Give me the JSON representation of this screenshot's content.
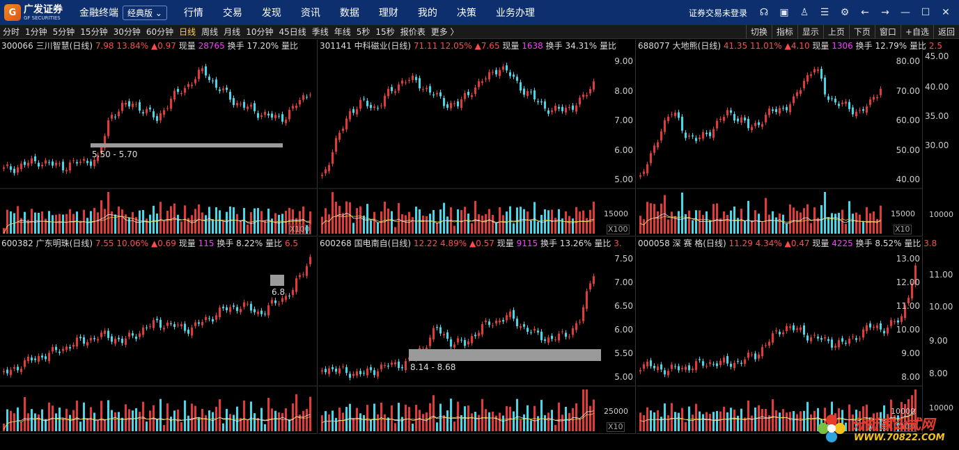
{
  "titlebar": {
    "logo_cn": "广发证券",
    "logo_en": "GF SECURITIES",
    "app_name": "金融终端",
    "edition": "经典版",
    "menu": [
      "行情",
      "交易",
      "发现",
      "资讯",
      "数据",
      "理财",
      "我的",
      "决策",
      "业务办理"
    ],
    "login_status": "证券交易未登录",
    "icons": [
      "headset-icon",
      "grid-icon",
      "shirt-icon",
      "doc-icon",
      "gear-icon",
      "back-arrow-icon",
      "forward-arrow-icon",
      "minimize-icon",
      "maximize-icon",
      "close-icon"
    ]
  },
  "period_bar": {
    "items": [
      "分时",
      "1分钟",
      "5分钟",
      "15分钟",
      "30分钟",
      "60分钟",
      "日线",
      "周线",
      "月线",
      "10分钟",
      "45日线",
      "季线",
      "年线",
      "5秒",
      "15秒",
      "报价表",
      "更多 〉"
    ],
    "active": "日线",
    "tools": [
      "切换",
      "指标",
      "显示",
      "上页",
      "下页",
      "窗口",
      "+自选",
      "返回"
    ]
  },
  "panels": [
    {
      "code": "300066",
      "name": "三川智慧(日线)",
      "price": "7.98",
      "pct": "13.84%",
      "chg": "▲0.97",
      "vol_label": "现量",
      "vol": "28765",
      "turn": "换手 17.20%",
      "ratio": "量比",
      "yticks": [],
      "vticks": [
        "X100"
      ],
      "band_label": "5.50 - 5.70"
    },
    {
      "code": "301141",
      "name": "中科磁业(日线)",
      "price": "71.11",
      "pct": "12.05%",
      "chg": "▲7.65",
      "vol_label": "现量",
      "vol": "1638",
      "turn": "换手 34.31%",
      "ratio": "量比",
      "yticks": [
        "9.00",
        "8.00",
        "7.00",
        "6.00",
        "5.00"
      ],
      "vticks": [
        "15000",
        "X100"
      ],
      "band_label": ""
    },
    {
      "code": "688077",
      "name": "大地熊(日线)",
      "price": "41.35",
      "pct": "11.01%",
      "chg": "▲4.10",
      "vol_label": "现量",
      "vol": "1306",
      "turn": "换手 12.79%",
      "ratio": "量比",
      "ratio_val": "2.5",
      "yticks": [
        "80.00",
        "70.00",
        "60.00",
        "50.00",
        "40.00"
      ],
      "vticks": [
        "15000",
        "X10"
      ],
      "band_label": ""
    },
    {
      "code": "600382",
      "name": "广东明珠(日线)",
      "price": "7.55",
      "pct": "10.06%",
      "chg": "▲0.69",
      "vol_label": "现量",
      "vol": "115",
      "turn": "换手 8.22%",
      "ratio": "量比",
      "ratio_val": "6.5",
      "yticks": [],
      "vticks": [],
      "band_label": "6.8"
    },
    {
      "code": "600268",
      "name": "国电南自(日线)",
      "price": "12.22",
      "pct": "4.89%",
      "chg": "▲0.57",
      "vol_label": "现量",
      "vol": "9115",
      "turn": "换手 13.26%",
      "ratio": "量比",
      "ratio_val": "3.",
      "yticks": [
        "7.50",
        "7.00",
        "6.50",
        "6.00",
        "5.50",
        "5.00"
      ],
      "vticks": [
        "25000",
        "X10"
      ],
      "band_label": "8.14 - 8.68"
    },
    {
      "code": "000058",
      "name": "深 赛 格(日线)",
      "price": "11.29",
      "pct": "4.34%",
      "chg": "▲0.47",
      "vol_label": "现量",
      "vol": "4225",
      "turn": "换手 8.52%",
      "ratio": "量比",
      "ratio_val": "3.8",
      "yticks": [
        "13.00",
        "12.00",
        "11.00",
        "10.00",
        "9.00",
        "8.00"
      ],
      "vticks": [
        "10000",
        "X100"
      ],
      "band_label": ""
    }
  ],
  "right_axis": {
    "top": [
      "45.00",
      "40.00",
      "35.00",
      "30.00"
    ],
    "top_vol": "10000",
    "bottom": [
      "11.00",
      "10.00",
      "9.00",
      "8.00"
    ],
    "bottom_vol": "10000"
  },
  "watermark": {
    "title": "分析家公式网",
    "url": "WWW.70822.COM"
  },
  "colors": {
    "up": "#e03a3a",
    "down": "#46d7e8",
    "ma1": "#f0f0f0",
    "ma2": "#e6d14a",
    "titlebar": "#0d2f6e"
  }
}
